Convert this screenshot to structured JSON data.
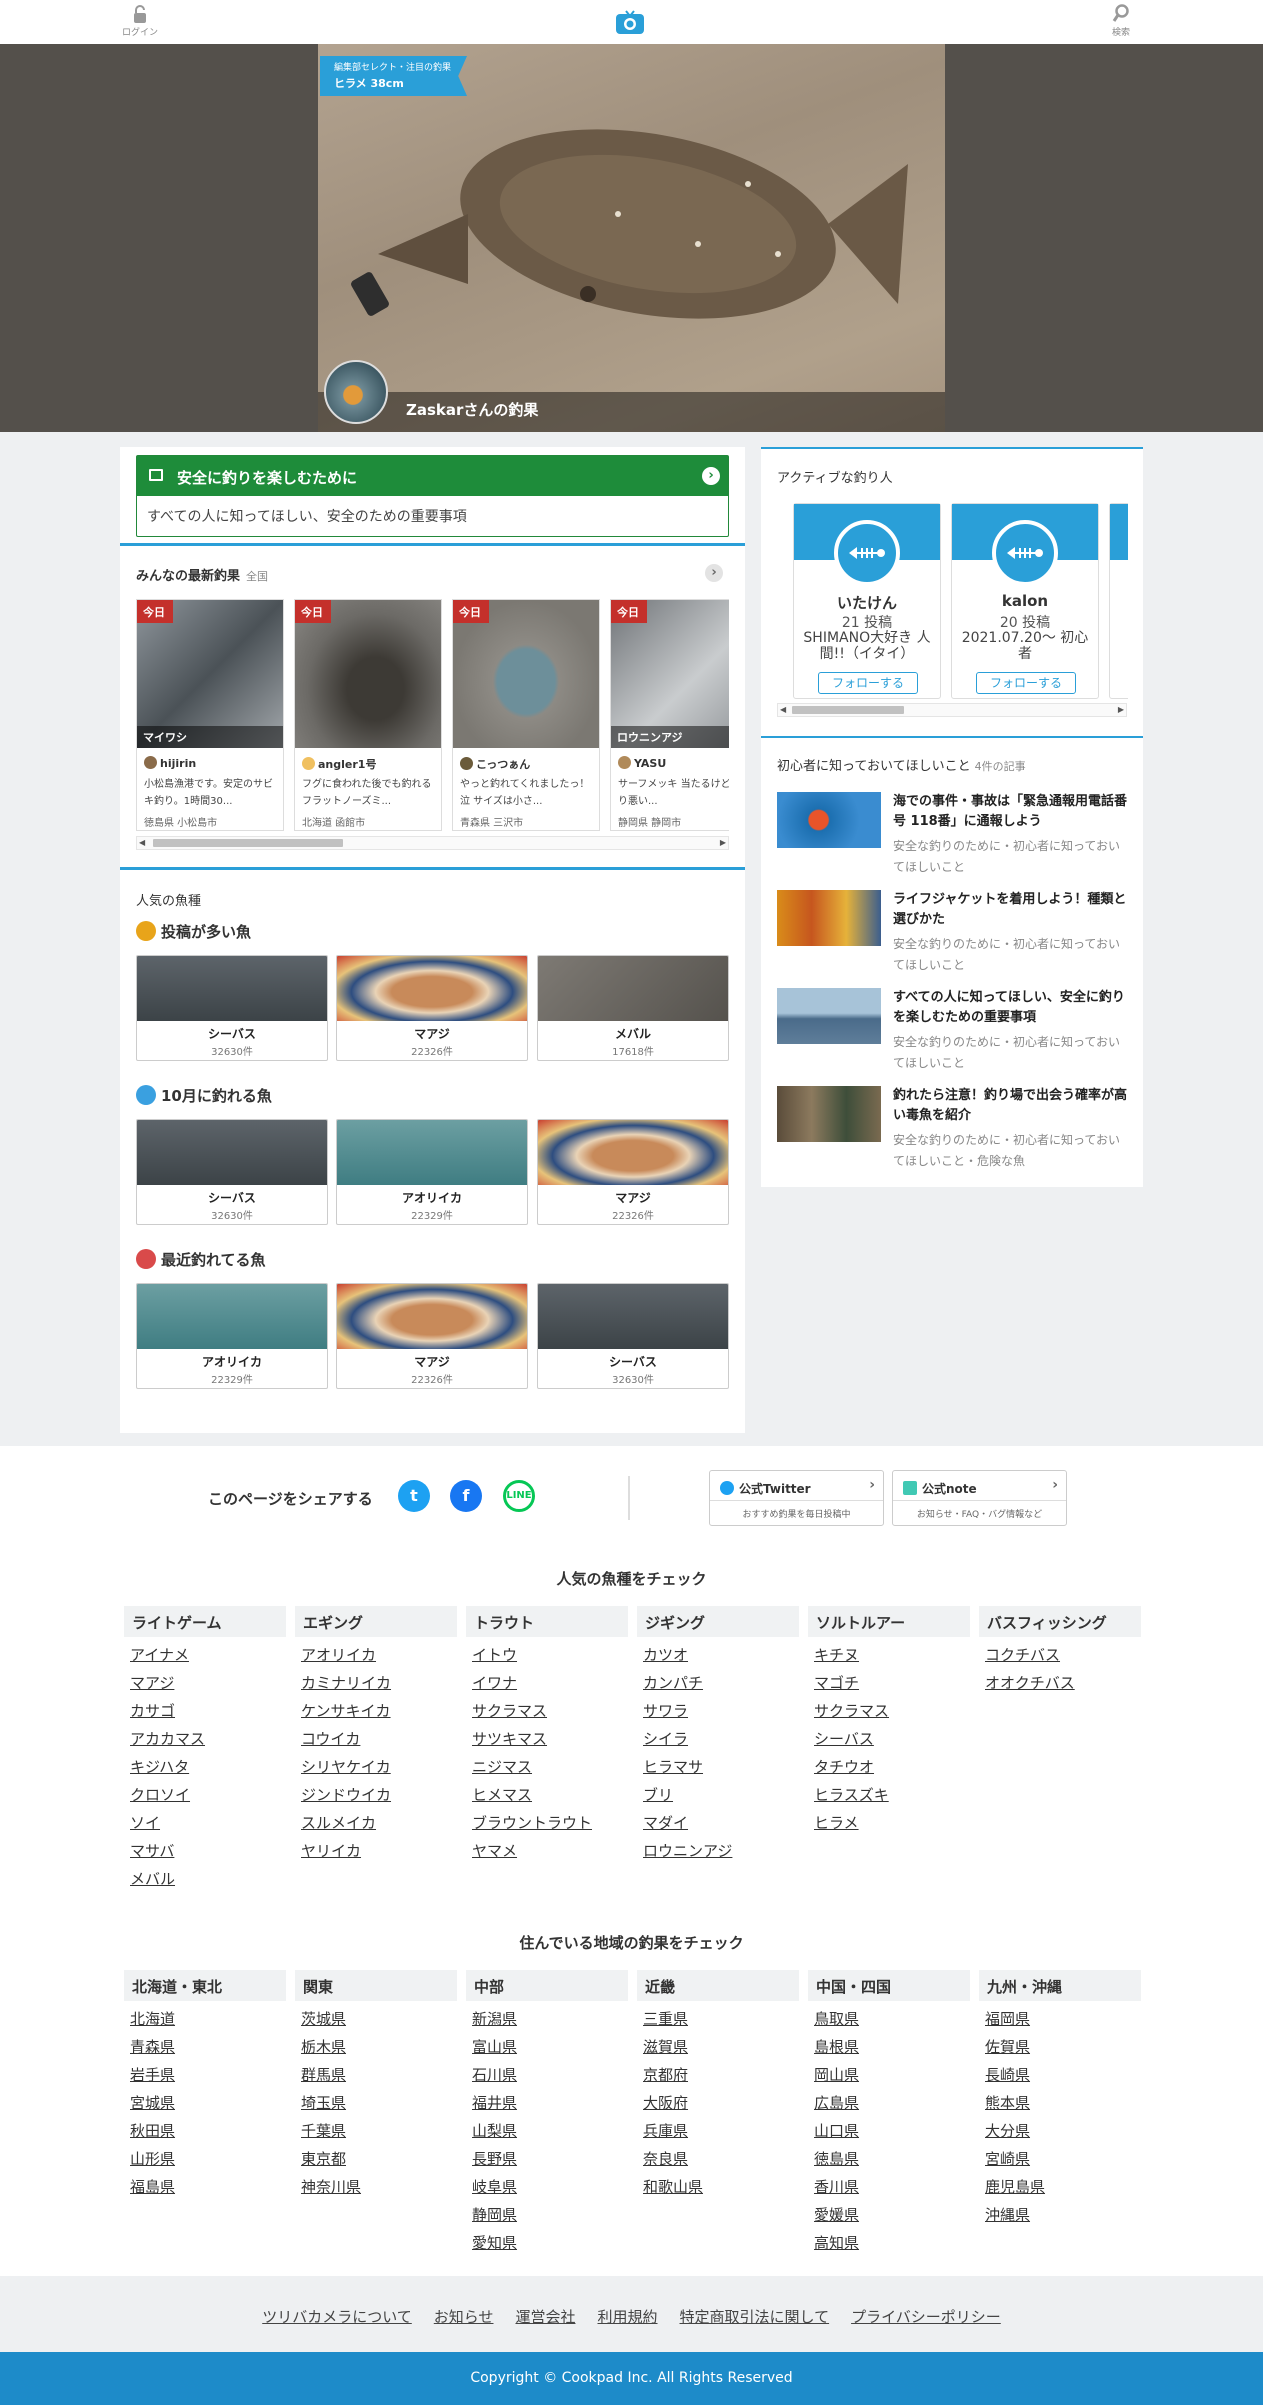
{
  "header": {
    "login_label": "ログイン",
    "search_label": "検索"
  },
  "hero": {
    "tag_small": "編集部セレクト・注目の釣果",
    "tag_main": "ヒラメ 38cm",
    "user_caption": "Zaskarさんの釣果"
  },
  "safety": {
    "title": "安全に釣りを楽しむために",
    "subtitle": "すべての人に知ってほしい、安全のための重要事項"
  },
  "latest": {
    "title": "みんなの最新釣果",
    "scope": "全国",
    "cards": [
      {
        "badge": "今日",
        "fish": "マイワシ",
        "user": "hijirin",
        "desc": "小松島漁港です。安定のサビキ釣り。1時間30...",
        "place": "徳島県 小松島市"
      },
      {
        "badge": "今日",
        "fish": "",
        "user": "angler1号",
        "desc": "フグに食われた後でも釣れるフラットノーズミ...",
        "place": "北海道 函館市"
      },
      {
        "badge": "今日",
        "fish": "",
        "user": "こっつぁん",
        "desc": "やっと釣れてくれましたっ！泣 サイズは小さ...",
        "place": "青森県 三沢市"
      },
      {
        "badge": "今日",
        "fish": "ロウニンアジ",
        "user": "YASU",
        "desc": "サーフメッキ 当たるけど、乗り悪い...",
        "place": "静岡県 静岡市"
      }
    ]
  },
  "popular": {
    "title": "人気の魚種",
    "groups": [
      {
        "title": "投稿が多い魚",
        "tiles": [
          {
            "name": "シーバス",
            "count": "32630件"
          },
          {
            "name": "マアジ",
            "count": "22326件"
          },
          {
            "name": "メバル",
            "count": "17618件"
          }
        ]
      },
      {
        "title": "10月に釣れる魚",
        "tiles": [
          {
            "name": "シーバス",
            "count": "32630件"
          },
          {
            "name": "アオリイカ",
            "count": "22329件"
          },
          {
            "name": "マアジ",
            "count": "22326件"
          }
        ]
      },
      {
        "title": "最近釣れてる魚",
        "tiles": [
          {
            "name": "アオリイカ",
            "count": "22329件"
          },
          {
            "name": "マアジ",
            "count": "22326件"
          },
          {
            "name": "シーバス",
            "count": "32630件"
          }
        ]
      }
    ]
  },
  "active": {
    "title": "アクティブな釣り人",
    "anglers": [
      {
        "name": "いたけん",
        "posts": "21 投稿",
        "profile": "SHIMANO大好き 人間!!（イタイ）",
        "follow": "フォローする"
      },
      {
        "name": "kalon",
        "posts": "20 投稿",
        "profile": "2021.07.20〜 初心者",
        "follow": "フォローする"
      }
    ]
  },
  "beginner": {
    "title": "初心者に知っておいてほしいこと",
    "count": "4件の記事",
    "items": [
      {
        "title": "海での事件・事故は「緊急通報用電話番号 118番」に通報しよう",
        "tags": "安全な釣りのために・初心者に知っておいてほしいこと"
      },
      {
        "title": "ライフジャケットを着用しよう！種類と選びかた",
        "tags": "安全な釣りのために・初心者に知っておいてほしいこと"
      },
      {
        "title": "すべての人に知ってほしい、安全に釣りを楽しむための重要事項",
        "tags": "安全な釣りのために・初心者に知っておいてほしいこと"
      },
      {
        "title": "釣れたら注意！釣り場で出会う確率が高い毒魚を紹介",
        "tags": "安全な釣りのために・初心者に知っておいてほしいこと・危険な魚"
      }
    ]
  },
  "share": {
    "label": "このページをシェアする",
    "twitter": {
      "title": "公式Twitter",
      "sub": "おすすめ釣果を毎日投稿中"
    },
    "note": {
      "title": "公式note",
      "sub": "お知らせ・FAQ・バグ情報など"
    }
  },
  "fish_check": {
    "title": "人気の魚種をチェック",
    "columns": [
      {
        "head": "ライトゲーム",
        "items": [
          "アイナメ",
          "マアジ",
          "カサゴ",
          "アカカマス",
          "キジハタ",
          "クロソイ",
          "ソイ",
          "マサバ",
          "メバル"
        ]
      },
      {
        "head": "エギング",
        "items": [
          "アオリイカ",
          "カミナリイカ",
          "ケンサキイカ",
          "コウイカ",
          "シリヤケイカ",
          "ジンドウイカ",
          "スルメイカ",
          "ヤリイカ"
        ]
      },
      {
        "head": "トラウト",
        "items": [
          "イトウ",
          "イワナ",
          "サクラマス",
          "サツキマス",
          "ニジマス",
          "ヒメマス",
          "ブラウントラウト",
          "ヤマメ"
        ]
      },
      {
        "head": "ジギング",
        "items": [
          "カツオ",
          "カンパチ",
          "サワラ",
          "シイラ",
          "ヒラマサ",
          "ブリ",
          "マダイ",
          "ロウニンアジ"
        ]
      },
      {
        "head": "ソルトルアー",
        "items": [
          "キチヌ",
          "マゴチ",
          "サクラマス",
          "シーバス",
          "タチウオ",
          "ヒラスズキ",
          "ヒラメ"
        ]
      },
      {
        "head": "バスフィッシング",
        "items": [
          "コクチバス",
          "オオクチバス"
        ]
      }
    ]
  },
  "region_check": {
    "title": "住んでいる地域の釣果をチェック",
    "columns": [
      {
        "head": "北海道・東北",
        "items": [
          "北海道",
          "青森県",
          "岩手県",
          "宮城県",
          "秋田県",
          "山形県",
          "福島県"
        ]
      },
      {
        "head": "関東",
        "items": [
          "茨城県",
          "栃木県",
          "群馬県",
          "埼玉県",
          "千葉県",
          "東京都",
          "神奈川県"
        ]
      },
      {
        "head": "中部",
        "items": [
          "新潟県",
          "富山県",
          "石川県",
          "福井県",
          "山梨県",
          "長野県",
          "岐阜県",
          "静岡県",
          "愛知県"
        ]
      },
      {
        "head": "近畿",
        "items": [
          "三重県",
          "滋賀県",
          "京都府",
          "大阪府",
          "兵庫県",
          "奈良県",
          "和歌山県"
        ]
      },
      {
        "head": "中国・四国",
        "items": [
          "鳥取県",
          "島根県",
          "岡山県",
          "広島県",
          "山口県",
          "徳島県",
          "香川県",
          "愛媛県",
          "高知県"
        ]
      },
      {
        "head": "九州・沖縄",
        "items": [
          "福岡県",
          "佐賀県",
          "長崎県",
          "熊本県",
          "大分県",
          "宮崎県",
          "鹿児島県",
          "沖縄県"
        ]
      }
    ]
  },
  "footer": {
    "links": [
      "ツリバカメラについて",
      "お知らせ",
      "運営会社",
      "利用規約",
      "特定商取引法に関して",
      "プライバシーポリシー"
    ],
    "copyright": "Copyright © Cookpad Inc. All Rights Reserved"
  },
  "colors": {
    "accent": "#2a9fd8",
    "safety_green": "#1e8c3a",
    "today_red": "#c4302b",
    "footer_blue": "#1d8bc9"
  }
}
